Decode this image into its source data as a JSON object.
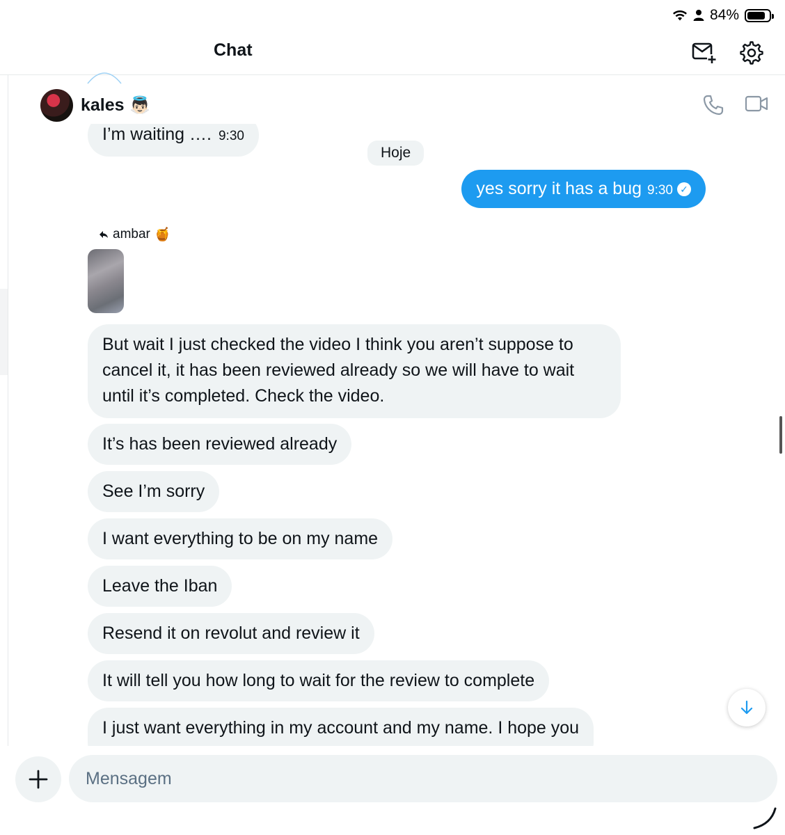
{
  "status_bar": {
    "battery": "84%",
    "battery_level": 0.84
  },
  "header": {
    "title": "Chat",
    "icons": [
      "new-message-icon",
      "settings-icon"
    ]
  },
  "conversation": {
    "name": "kales",
    "name_emoji": "👼🏻",
    "icons": [
      "phone-icon",
      "video-icon"
    ]
  },
  "messages": {
    "received_prev": {
      "text": "I’m waiting ….",
      "time": "9:30"
    },
    "date_divider": "Hoje",
    "sent": {
      "text": "yes sorry it has a bug",
      "time": "9:30",
      "status_icon": "check-circle-icon"
    },
    "reply_label": "ambar",
    "reply_emoji": "🍯",
    "received": [
      "But wait I just checked the video I think you aren’t suppose to",
      "cancel it, it has been reviewed already so we will have to wait",
      "until it’s completed. Check the video.",
      "It’s has been reviewed already",
      "See I’m sorry",
      "I want everything to be on my name",
      "Leave the Iban",
      "Resend it on revolut and review it",
      "It will tell you how long to wait for the review to complete",
      "I just want everything in my account and my name. I hope you"
    ]
  },
  "composer": {
    "placeholder": "Mensagem"
  },
  "colors": {
    "accent": "#1d9bf0",
    "bubble": "#eff3f4",
    "text": "#0f1419"
  }
}
